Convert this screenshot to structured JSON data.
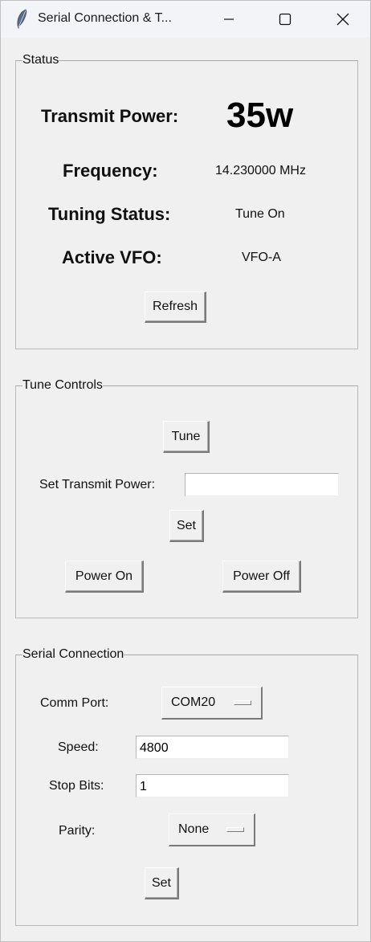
{
  "window": {
    "title": "Serial Connection & T...",
    "app_icon": "feather-icon",
    "controls": [
      "minimize-icon",
      "maximize-icon",
      "close-icon"
    ]
  },
  "status": {
    "legend": "Status",
    "transmit_power_label": "Transmit Power:",
    "transmit_power_value": "35w",
    "frequency_label": "Frequency:",
    "frequency_value": "14.230000 MHz",
    "tuning_status_label": "Tuning Status:",
    "tuning_status_value": "Tune On",
    "active_vfo_label": "Active VFO:",
    "active_vfo_value": "VFO-A",
    "refresh_label": "Refresh"
  },
  "tune_controls": {
    "legend": "Tune Controls",
    "tune_label": "Tune",
    "set_power_label": "Set Transmit Power:",
    "set_power_value": "",
    "set_label": "Set",
    "power_on_label": "Power On",
    "power_off_label": "Power Off"
  },
  "serial": {
    "legend": "Serial Connection",
    "comm_port_label": "Comm Port:",
    "comm_port_value": "COM20",
    "speed_label": "Speed:",
    "speed_value": "4800",
    "stop_bits_label": "Stop Bits:",
    "stop_bits_value": "1",
    "parity_label": "Parity:",
    "parity_value": "None",
    "set_label": "Set"
  },
  "colors": {
    "window_bg": "#f0f0f0",
    "titlebar_bg": "#f3f4f8",
    "text": "#111111",
    "entry_bg": "#ffffff",
    "group_border": "#b9b9b9"
  }
}
